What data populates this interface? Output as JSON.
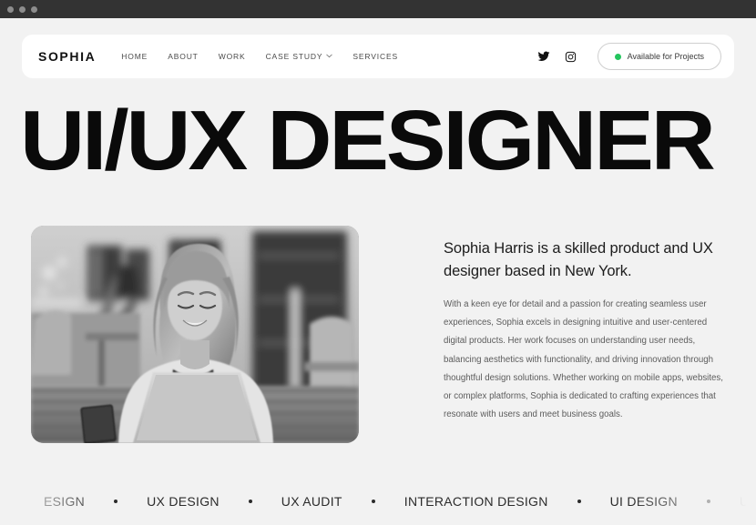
{
  "window": {
    "traffic_dots": [
      "dot-1",
      "dot-2",
      "dot-3"
    ]
  },
  "nav": {
    "logo": "SOPHIA",
    "links": [
      {
        "label": "HOME",
        "has_chevron": false
      },
      {
        "label": "ABOUT",
        "has_chevron": false
      },
      {
        "label": "WORK",
        "has_chevron": false
      },
      {
        "label": "CASE STUDY",
        "has_chevron": true
      },
      {
        "label": "SERVICES",
        "has_chevron": false
      }
    ],
    "social": [
      {
        "name": "twitter-icon"
      },
      {
        "name": "instagram-icon"
      }
    ],
    "availability": {
      "label": "Available for Projects",
      "dot_color": "#24c55e"
    }
  },
  "hero": {
    "title": "UI/UX DESIGNER"
  },
  "about": {
    "photo_alt": "Smiling woman working on a laptop at a wooden table",
    "intro": "Sophia Harris is a skilled product and UX designer based in New York.",
    "body": "With a keen eye for detail and a passion for creating seamless user experiences, Sophia excels in designing intuitive and user-centered digital products. Her work focuses on understanding user needs, balancing aesthetics with functionality, and driving innovation through thoughtful design solutions. Whether working on mobile apps, websites, or complex platforms, Sophia is dedicated to crafting experiences that resonate with users and meet business goals."
  },
  "marquee": {
    "items": [
      "ESIGN",
      "UX DESIGN",
      "UX AUDIT",
      "INTERACTION DESIGN",
      "UI DESIGN",
      "UX DESIGN"
    ]
  },
  "colors": {
    "page_bg": "#f2f2f2",
    "chrome_bg": "#333333",
    "card_bg": "#ffffff",
    "heading": "#0a0a0a",
    "body_text": "#5c5c5c",
    "accent_green": "#24c55e"
  }
}
